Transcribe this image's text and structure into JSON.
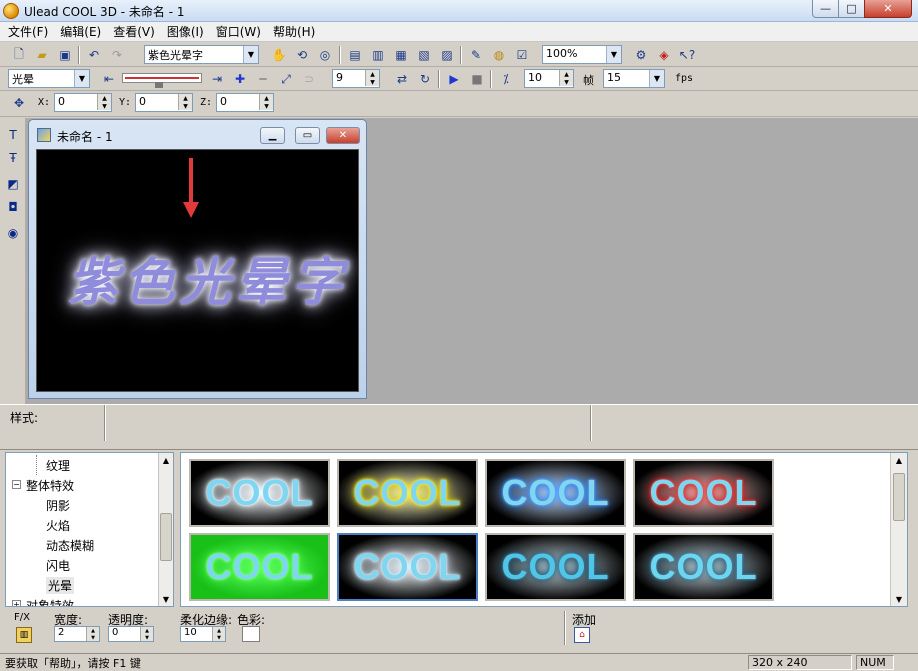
{
  "window": {
    "title": "Ulead COOL 3D - 未命名 - 1",
    "minimize": "—",
    "maximize": "□",
    "close": "✕"
  },
  "menu": [
    "文件(F)",
    "编辑(E)",
    "查看(V)",
    "图像(I)",
    "窗口(W)",
    "帮助(H)"
  ],
  "toolbar1": {
    "text_preset": "紫色光晕字",
    "zoom": "100%"
  },
  "toolbar2": {
    "effect_category": "光晕",
    "frame_value": "9",
    "frames_total": "10",
    "frame_label": "帧",
    "fps_value": "15",
    "fps_label": "fps"
  },
  "toolbar3": {
    "x_label": "X:",
    "x_value": "0",
    "y_label": "Y:",
    "y_value": "0",
    "z_label": "Z:",
    "z_value": "0"
  },
  "document": {
    "title": "未命名 - 1",
    "canvas_text": "紫色光晕字"
  },
  "style_bar": {
    "label": "样式:"
  },
  "tree": {
    "items": [
      {
        "label": "纹理",
        "indent": 2
      },
      {
        "label": "整体特效",
        "indent": 1,
        "expander": "−"
      },
      {
        "label": "阴影",
        "indent": 2
      },
      {
        "label": "火焰",
        "indent": 2
      },
      {
        "label": "动态模糊",
        "indent": 2
      },
      {
        "label": "闪电",
        "indent": 2
      },
      {
        "label": "光晕",
        "indent": 2,
        "selected": true
      },
      {
        "label": "对象特效",
        "indent": 1,
        "expander": "+"
      }
    ]
  },
  "thumbnails": [
    {
      "text": "COOL",
      "bg": "#000000",
      "fg": "#7fd6f0",
      "glow": "#e8f6ff"
    },
    {
      "text": "COOL",
      "bg": "#000000",
      "fg": "#7fd6f0",
      "glow": "#f2e600"
    },
    {
      "text": "COOL",
      "bg": "#000000",
      "fg": "#7fd6f0",
      "glow": "#1d7fff"
    },
    {
      "text": "COOL",
      "bg": "#000000",
      "fg": "#7fd6f0",
      "glow": "#e01010"
    },
    {
      "text": "COOL",
      "bg": "#18c018",
      "fg": "#7fd6f0",
      "glow": "#5cff5c"
    },
    {
      "text": "COOL",
      "bg": "#000000",
      "fg": "#7fd6f0",
      "glow": "#cfe6f5",
      "selected": true
    },
    {
      "text": "COOL",
      "bg": "#000000",
      "fg": "#4ec6ea",
      "glow": "#0a4a6a"
    },
    {
      "text": "COOL",
      "bg": "#000000",
      "fg": "#6bd6f2",
      "glow": "#1a5a7a"
    }
  ],
  "controls": {
    "fx_label": "F/X",
    "width_label": "宽度:",
    "width_value": "2",
    "opacity_label": "透明度:",
    "opacity_value": "0",
    "soften_label": "柔化边缘:",
    "soften_value": "10",
    "color_label": "色彩:",
    "add_label": "添加"
  },
  "status": {
    "help_text": "要获取「帮助」，请按 F1 键",
    "size": "320 x 240",
    "num": "NUM"
  }
}
